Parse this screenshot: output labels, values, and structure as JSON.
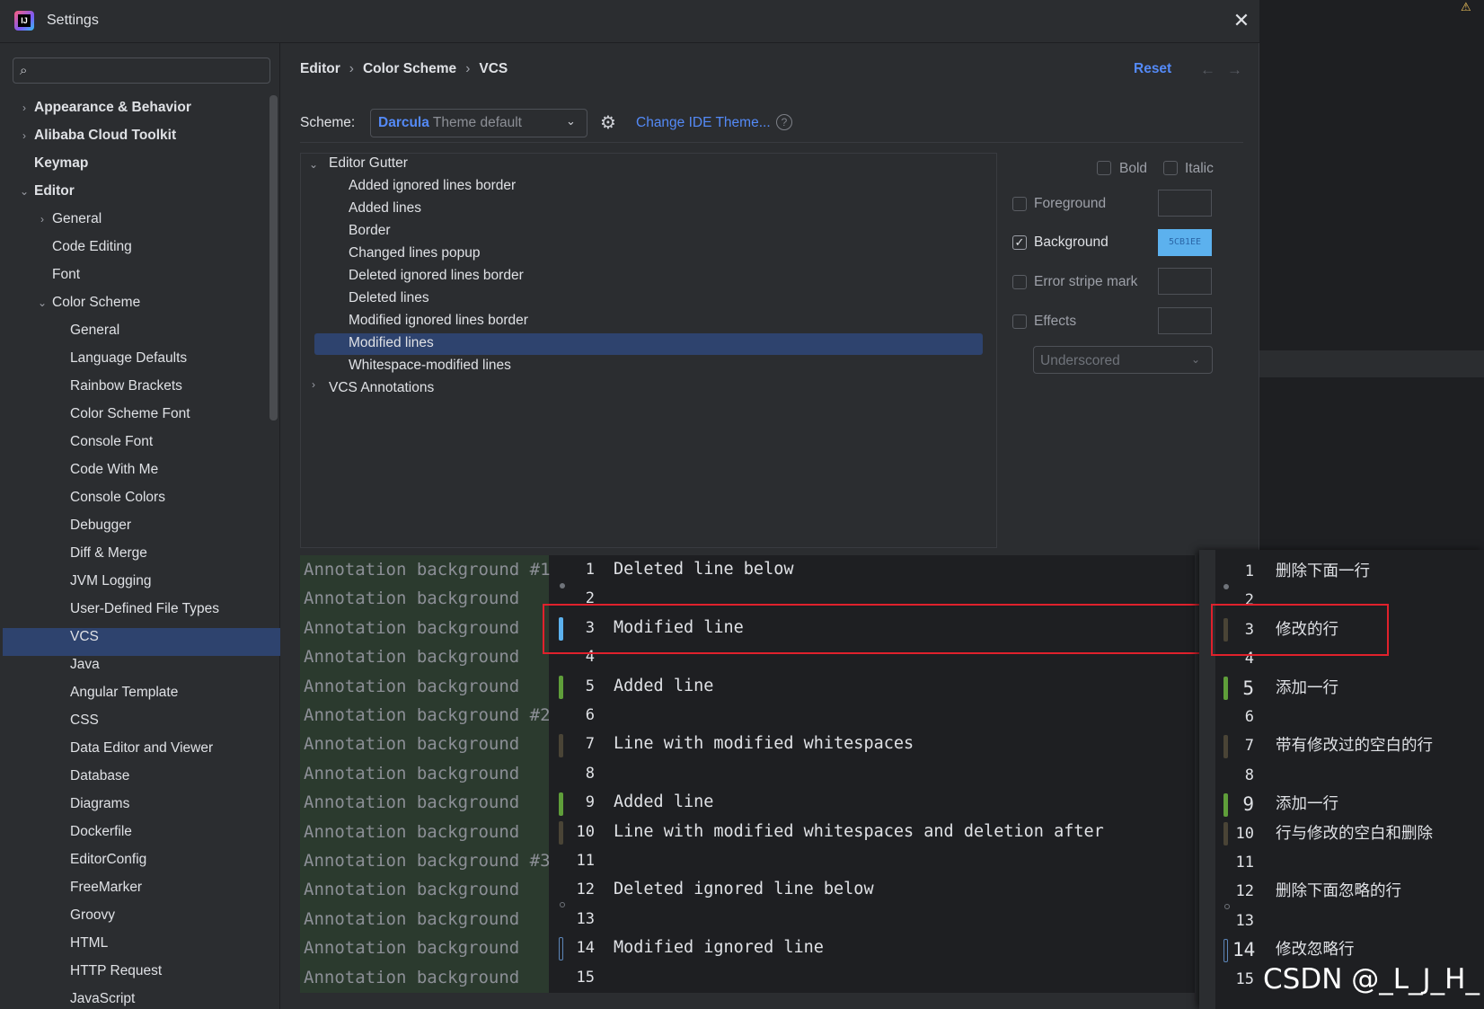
{
  "window": {
    "title": "Settings"
  },
  "sidebar": {
    "items": [
      {
        "label": "Appearance & Behavior",
        "bold": true,
        "level": 0,
        "chevron": "right"
      },
      {
        "label": "Alibaba Cloud Toolkit",
        "bold": true,
        "level": 0,
        "chevron": "right"
      },
      {
        "label": "Keymap",
        "bold": true,
        "level": 0,
        "chevron": ""
      },
      {
        "label": "Editor",
        "bold": true,
        "level": 0,
        "chevron": "down"
      },
      {
        "label": "General",
        "bold": false,
        "level": 1,
        "chevron": "right"
      },
      {
        "label": "Code Editing",
        "bold": false,
        "level": 1,
        "chevron": ""
      },
      {
        "label": "Font",
        "bold": false,
        "level": 1,
        "chevron": ""
      },
      {
        "label": "Color Scheme",
        "bold": false,
        "level": 1,
        "chevron": "down"
      },
      {
        "label": "General",
        "bold": false,
        "level": 2,
        "chevron": ""
      },
      {
        "label": "Language Defaults",
        "bold": false,
        "level": 2,
        "chevron": ""
      },
      {
        "label": "Rainbow Brackets",
        "bold": false,
        "level": 2,
        "chevron": ""
      },
      {
        "label": "Color Scheme Font",
        "bold": false,
        "level": 2,
        "chevron": ""
      },
      {
        "label": "Console Font",
        "bold": false,
        "level": 2,
        "chevron": ""
      },
      {
        "label": "Code With Me",
        "bold": false,
        "level": 2,
        "chevron": ""
      },
      {
        "label": "Console Colors",
        "bold": false,
        "level": 2,
        "chevron": ""
      },
      {
        "label": "Debugger",
        "bold": false,
        "level": 2,
        "chevron": ""
      },
      {
        "label": "Diff & Merge",
        "bold": false,
        "level": 2,
        "chevron": ""
      },
      {
        "label": "JVM Logging",
        "bold": false,
        "level": 2,
        "chevron": ""
      },
      {
        "label": "User-Defined File Types",
        "bold": false,
        "level": 2,
        "chevron": ""
      },
      {
        "label": "VCS",
        "bold": false,
        "level": 2,
        "chevron": "",
        "selected": true
      },
      {
        "label": "Java",
        "bold": false,
        "level": 2,
        "chevron": ""
      },
      {
        "label": "Angular Template",
        "bold": false,
        "level": 2,
        "chevron": ""
      },
      {
        "label": "CSS",
        "bold": false,
        "level": 2,
        "chevron": ""
      },
      {
        "label": "Data Editor and Viewer",
        "bold": false,
        "level": 2,
        "chevron": ""
      },
      {
        "label": "Database",
        "bold": false,
        "level": 2,
        "chevron": ""
      },
      {
        "label": "Diagrams",
        "bold": false,
        "level": 2,
        "chevron": ""
      },
      {
        "label": "Dockerfile",
        "bold": false,
        "level": 2,
        "chevron": ""
      },
      {
        "label": "EditorConfig",
        "bold": false,
        "level": 2,
        "chevron": ""
      },
      {
        "label": "FreeMarker",
        "bold": false,
        "level": 2,
        "chevron": ""
      },
      {
        "label": "Groovy",
        "bold": false,
        "level": 2,
        "chevron": ""
      },
      {
        "label": "HTML",
        "bold": false,
        "level": 2,
        "chevron": ""
      },
      {
        "label": "HTTP Request",
        "bold": false,
        "level": 2,
        "chevron": ""
      },
      {
        "label": "JavaScript",
        "bold": false,
        "level": 2,
        "chevron": ""
      }
    ]
  },
  "breadcrumb": [
    "Editor",
    "Color Scheme",
    "VCS"
  ],
  "toolbar": {
    "reset": "Reset",
    "back": "←",
    "forward": "→"
  },
  "scheme": {
    "label": "Scheme:",
    "name": "Darcula",
    "suffix": "Theme default",
    "change_theme": "Change IDE Theme...",
    "help": "?"
  },
  "tree": {
    "group1": "Editor Gutter",
    "items": [
      "Added ignored lines border",
      "Added lines",
      "Border",
      "Changed lines popup",
      "Deleted ignored lines border",
      "Deleted lines",
      "Modified ignored lines border",
      "Modified lines",
      "Whitespace-modified lines"
    ],
    "group2": "VCS Annotations"
  },
  "props": {
    "bold": "Bold",
    "italic": "Italic",
    "foreground": "Foreground",
    "background": "Background",
    "background_value": "5CB1EE",
    "error_stripe": "Error stripe mark",
    "effects": "Effects",
    "effect_type": "Underscored",
    "background_color": "#5cb1ee"
  },
  "preview": {
    "annotations": [
      "Annotation background #1",
      "Annotation background",
      "Annotation background",
      "Annotation background",
      "Annotation background",
      "Annotation background #2",
      "Annotation background",
      "Annotation background",
      "Annotation background",
      "Annotation background",
      "Annotation background #3",
      "Annotation background",
      "Annotation background",
      "Annotation background",
      "Annotation background"
    ],
    "lines": [
      "Deleted line below",
      "",
      "Modified line",
      "",
      "Added line",
      "",
      "Line with modified whitespaces",
      "",
      "Added line",
      "Line with modified whitespaces and deletion after",
      "",
      "Deleted ignored line below",
      "",
      "Modified ignored line",
      ""
    ],
    "line_numbers": [
      "1",
      "2",
      "3",
      "4",
      "5",
      "6",
      "7",
      "8",
      "9",
      "10",
      "11",
      "12",
      "13",
      "14",
      "15"
    ]
  },
  "translation": {
    "lines": [
      "删除下面一行",
      "",
      "修改的行",
      "",
      "添加一行",
      "",
      "带有修改过的空白的行",
      "",
      "添加一行",
      "行与修改的空白和删除",
      "",
      "删除下面忽略的行",
      "",
      "修改忽略行",
      ""
    ],
    "line_numbers": [
      "1",
      "2",
      "3",
      "4",
      "5",
      "6",
      "7",
      "8",
      "9",
      "10",
      "11",
      "12",
      "13",
      "14",
      "15"
    ]
  },
  "watermark": "CSDN @_L_J_H_",
  "warning_glyph": "⚠",
  "colors": {
    "accent": "#548af7",
    "selection": "#2e436e",
    "highlight": "#e0212c"
  }
}
